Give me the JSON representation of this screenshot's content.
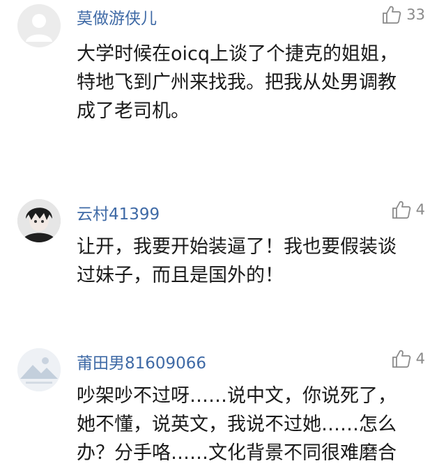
{
  "comments": [
    {
      "username": "莫做游侠儿",
      "likes": "33",
      "avatar": "default-gray",
      "lines": [
        "大学时候在oicq上谈了个捷克的姐姐，",
        "特地飞到广州来找我。把我从处男调教",
        "成了老司机。"
      ]
    },
    {
      "username": "云村41399",
      "likes": "4",
      "avatar": "anime-character",
      "lines": [
        "让开，我要开始装逼了！我也要假装谈",
        "过妹子，而且是国外的！"
      ]
    },
    {
      "username": "莆田男81609066",
      "likes": "4",
      "avatar": "default-landscape",
      "lines": [
        "吵架吵不过呀……说中文，你说死了，",
        "她不懂，说英文，我说不过她……怎么",
        "办？分手咯……文化背景不同很难磨合"
      ]
    }
  ],
  "icons": {
    "like": "thumbs-up-icon"
  },
  "colors": {
    "username": "#3f6aa6",
    "text": "#1a1a1a",
    "meta": "#8a8a8a"
  }
}
